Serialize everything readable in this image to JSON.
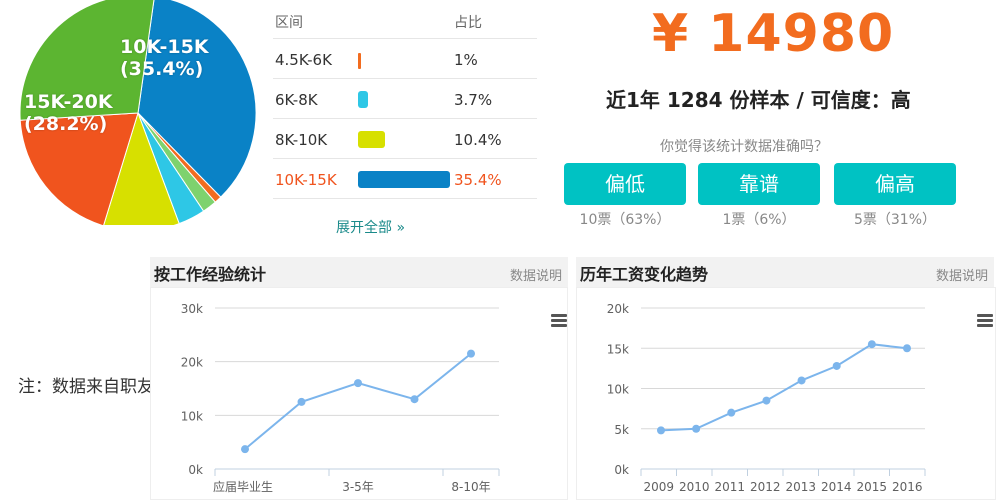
{
  "pie": {
    "labels": [
      {
        "name": "10K-15K",
        "pct": "(35.4%)"
      },
      {
        "name": "15K-20K",
        "pct": "(28.2%)"
      }
    ]
  },
  "distribution": {
    "header_range": "区间",
    "header_ratio": "占比",
    "rows": [
      {
        "range": "4.5K-6K",
        "percent": "1%",
        "value": 1,
        "color": "#f26c1f",
        "active": false
      },
      {
        "range": "6K-8K",
        "percent": "3.7%",
        "value": 3.7,
        "color": "#2ec7e6",
        "active": false
      },
      {
        "range": "8K-10K",
        "percent": "10.4%",
        "value": 10.4,
        "color": "#d7e000",
        "active": false
      },
      {
        "range": "10K-15K",
        "percent": "35.4%",
        "value": 35.4,
        "color": "#0a82c6",
        "active": true
      }
    ],
    "expand_label": "展开全部 »"
  },
  "chart_data": [
    {
      "type": "pie",
      "slices": [
        {
          "label": "10K-15K",
          "value": 35.4,
          "color": "#0a82c6"
        },
        {
          "label": "",
          "value": 1.0,
          "color": "#f26c1f"
        },
        {
          "label": "",
          "value": 2.0,
          "color": "#7ed26e"
        },
        {
          "label": "",
          "value": 3.7,
          "color": "#2ec7e6"
        },
        {
          "label": "",
          "value": 10.4,
          "color": "#d7e000"
        },
        {
          "label": "",
          "value": 19.3,
          "color": "#f0541e"
        },
        {
          "label": "15K-20K",
          "value": 28.2,
          "color": "#5cb531"
        }
      ]
    },
    {
      "type": "line",
      "title": "按工作经验统计",
      "x_ticks": [
        "应届毕业生",
        "3-5年",
        "8-10年"
      ],
      "y_ticks": [
        "0k",
        "10k",
        "20k",
        "30k"
      ],
      "ylim": [
        0,
        30000
      ],
      "values": [
        3700,
        12500,
        16000,
        13000,
        21500
      ],
      "color": "#7cb5ec"
    },
    {
      "type": "line",
      "title": "历年工资变化趋势",
      "categories": [
        "2009",
        "2010",
        "2011",
        "2012",
        "2013",
        "2014",
        "2015",
        "2016"
      ],
      "y_ticks": [
        "0k",
        "5k",
        "10k",
        "15k",
        "20k"
      ],
      "ylim": [
        0,
        20000
      ],
      "values": [
        4800,
        5000,
        7000,
        8500,
        11000,
        12800,
        15500,
        15000
      ],
      "color": "#7cb5ec"
    }
  ],
  "salary": {
    "amount": "¥ 14980",
    "sample_text": "近1年 1284 份样本 / 可信度：高",
    "question": "你觉得该统计数据准确吗？",
    "votes": [
      {
        "label": "偏低",
        "count": "10票（63%）"
      },
      {
        "label": "靠谱",
        "count": "1票（6%）"
      },
      {
        "label": "偏高",
        "count": "5票（31%）"
      }
    ],
    "button_color": "#00c2c3"
  },
  "note": "注：数据来自职友集",
  "panels": {
    "experience": {
      "title": "按工作经验统计",
      "note": "数据说明"
    },
    "trend": {
      "title": "历年工资变化趋势",
      "note": "数据说明"
    }
  }
}
